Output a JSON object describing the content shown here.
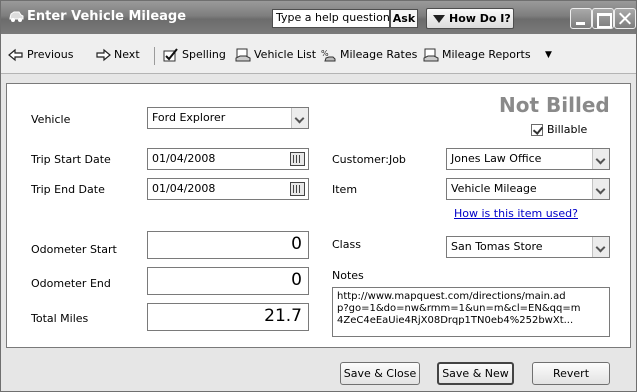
{
  "window": {
    "title": "Enter Vehicle Mileage",
    "help_placeholder": "Type a help question",
    "ask_label": "Ask",
    "howdoi_label": "How Do I?"
  },
  "toolbar": {
    "previous": "Previous",
    "next": "Next",
    "spelling": "Spelling",
    "vehicle_list": "Vehicle List",
    "mileage_rates": "Mileage Rates",
    "mileage_reports": "Mileage Reports"
  },
  "form": {
    "vehicle_label": "Vehicle",
    "vehicle_value": "Ford Explorer",
    "trip_start_label": "Trip Start Date",
    "trip_start_value": "01/04/2008",
    "trip_end_label": "Trip End Date",
    "trip_end_value": "01/04/2008",
    "odometer_start_label": "Odometer Start",
    "odometer_start_value": "0",
    "odometer_end_label": "Odometer End",
    "odometer_end_value": "0",
    "total_miles_label": "Total Miles",
    "total_miles_value": "21.7",
    "status": "Not Billed",
    "billable_label": "Billable",
    "billable_checked": true,
    "customer_job_label": "Customer:Job",
    "customer_job_value": "Jones Law Office",
    "item_label": "Item",
    "item_value": "Vehicle Mileage",
    "item_help_link": "How is this item used?",
    "class_label": "Class",
    "class_value": "San Tomas Store",
    "notes_label": "Notes",
    "notes_value": "http://www.mapquest.com/directions/main.ad\np?go=1&do=nw&rmm=1&un=m&cl=EN&qq=m\n4ZeC4eEaUie4RjX08Drqp1TN0eb4%252bwXt..."
  },
  "buttons": {
    "save_close": "Save & Close",
    "save_new": "Save & New",
    "revert": "Revert"
  }
}
